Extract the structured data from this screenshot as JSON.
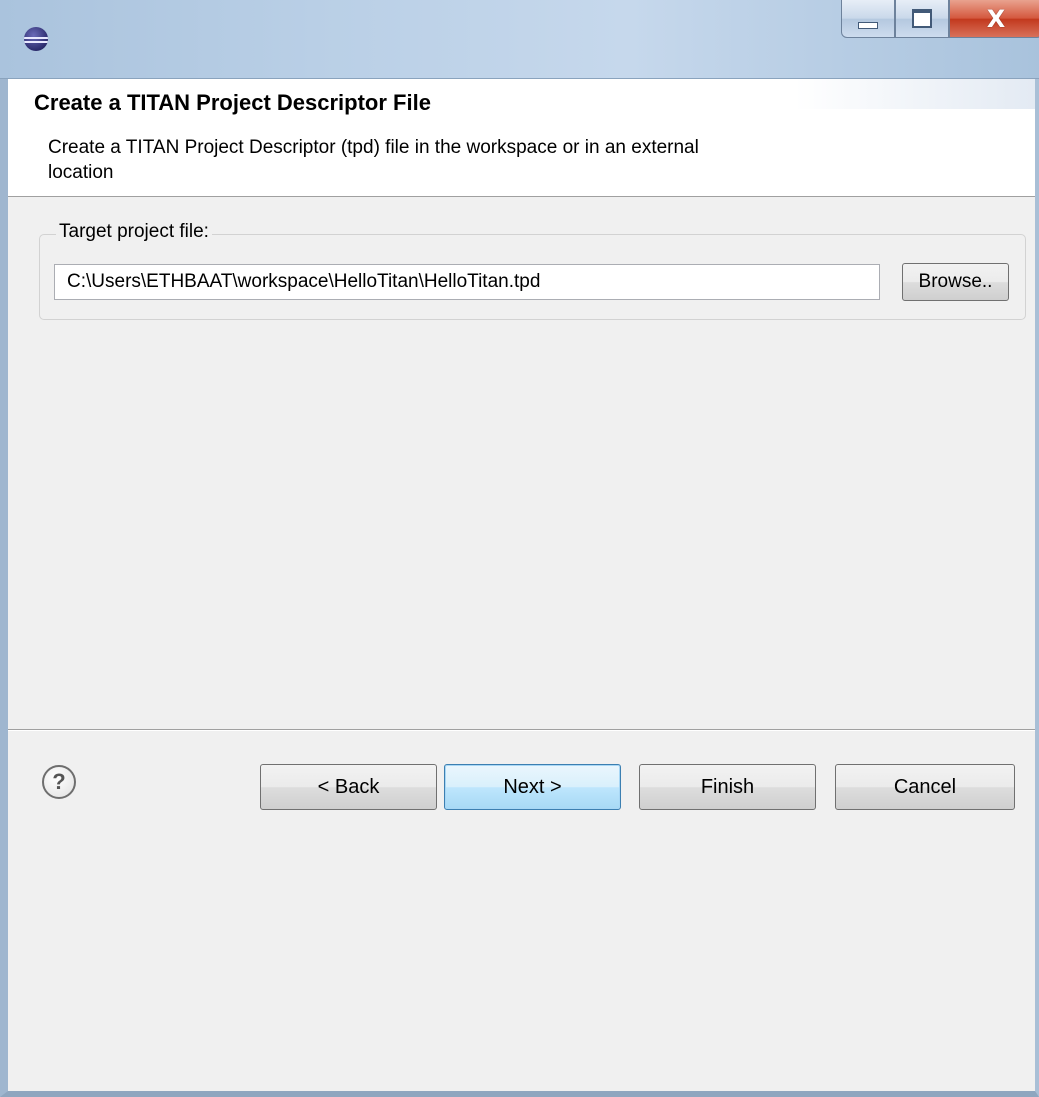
{
  "window": {
    "icon": "eclipse-icon",
    "controls": {
      "minimize_icon": "minimize-icon",
      "maximize_icon": "maximize-icon",
      "close_icon": "close-icon",
      "close_glyph": "X"
    }
  },
  "header": {
    "title": "Create a TITAN Project Descriptor File",
    "description": "Create a TITAN Project Descriptor (tpd) file in the workspace or in an external location"
  },
  "target_group": {
    "legend": "Target project file:",
    "path_value": "C:\\Users\\ETHBAAT\\workspace\\HelloTitan\\HelloTitan.tpd",
    "browse_label": "Browse.."
  },
  "footer": {
    "help_icon": "help-icon",
    "help_glyph": "?",
    "back_label": "< Back",
    "next_label": "Next >",
    "finish_label": "Finish",
    "cancel_label": "Cancel"
  },
  "colors": {
    "title_bar": "#b9cfe6",
    "close_button": "#c2381d",
    "dialog_bg": "#f0f0f0",
    "default_button_border": "#3c7fb1"
  }
}
